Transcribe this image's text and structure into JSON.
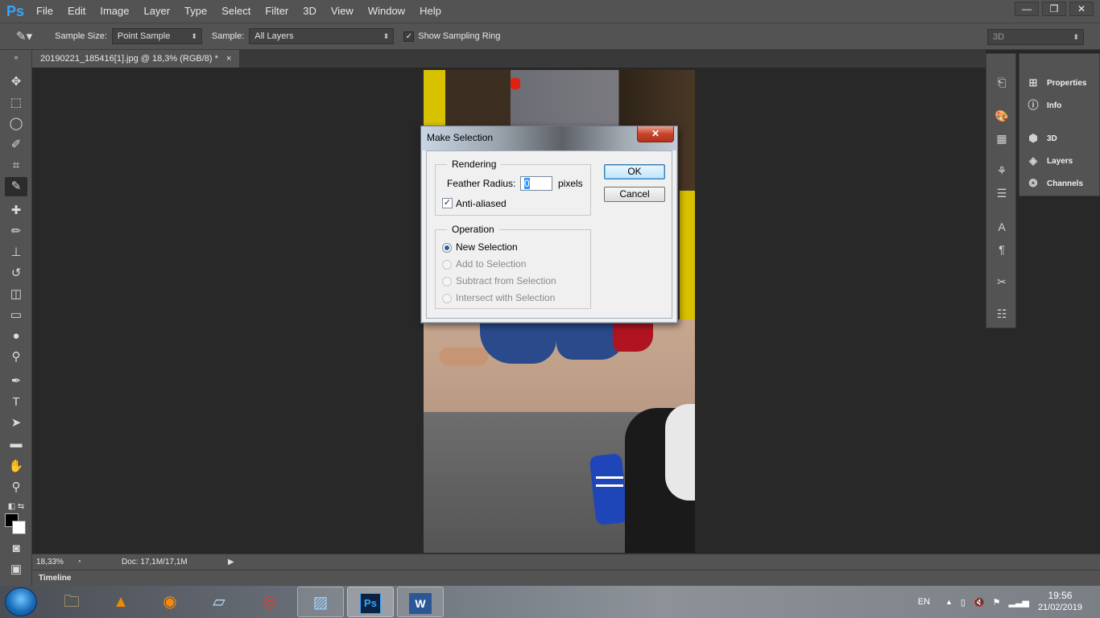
{
  "app": {
    "logo": "Ps",
    "title": "Adobe Photoshop"
  },
  "menu": [
    "File",
    "Edit",
    "Image",
    "Layer",
    "Type",
    "Select",
    "Filter",
    "3D",
    "View",
    "Window",
    "Help"
  ],
  "window_controls": {
    "minimize": "—",
    "restore": "❐",
    "close": "✕"
  },
  "options": {
    "sample_size_label": "Sample Size:",
    "sample_size_value": "Point Sample",
    "sample_label": "Sample:",
    "sample_value": "All Layers",
    "show_ring_label": "Show Sampling Ring",
    "show_ring_checked": true,
    "workspace_value": "3D"
  },
  "document": {
    "tab_title": "20190221_185416[1].jpg @ 18,3% (RGB/8) *",
    "tab_close": "×"
  },
  "status": {
    "zoom": "18,33%",
    "doc_size": "Doc: 17,1M/17,1M",
    "timeline_label": "Timeline"
  },
  "panels": {
    "items": [
      {
        "label": "Properties",
        "icon": "properties-icon"
      },
      {
        "label": "Info",
        "icon": "info-icon"
      },
      {
        "label": "3D",
        "icon": "cube-icon"
      },
      {
        "label": "Layers",
        "icon": "layers-icon"
      },
      {
        "label": "Channels",
        "icon": "channels-icon"
      }
    ]
  },
  "dialog": {
    "title": "Make Selection",
    "close": "✕",
    "rendering_legend": "Rendering",
    "feather_label": "Feather Radius:",
    "feather_value": "0",
    "feather_units": "pixels",
    "anti_aliased_label": "Anti-aliased",
    "anti_aliased_checked": true,
    "operation_legend": "Operation",
    "operations": [
      {
        "label": "New Selection",
        "selected": true,
        "enabled": true
      },
      {
        "label": "Add to Selection",
        "selected": false,
        "enabled": false
      },
      {
        "label": "Subtract from Selection",
        "selected": false,
        "enabled": false
      },
      {
        "label": "Intersect with Selection",
        "selected": false,
        "enabled": false
      }
    ],
    "ok_label": "OK",
    "cancel_label": "Cancel"
  },
  "taskbar": {
    "language": "EN",
    "time": "19:56",
    "date": "21/02/2019",
    "apps": [
      {
        "name": "file-explorer"
      },
      {
        "name": "vlc"
      },
      {
        "name": "firefox"
      },
      {
        "name": "notepad"
      },
      {
        "name": "chrome"
      },
      {
        "name": "photo-viewer"
      },
      {
        "name": "photoshop",
        "label": "Ps"
      },
      {
        "name": "word",
        "label": "W"
      }
    ]
  },
  "colors": {
    "ps_blue": "#31a8ff",
    "panel_gray": "#535353",
    "workspace_bg": "#282828",
    "dialog_bg": "#f0f0f0",
    "close_red": "#c7442a"
  }
}
